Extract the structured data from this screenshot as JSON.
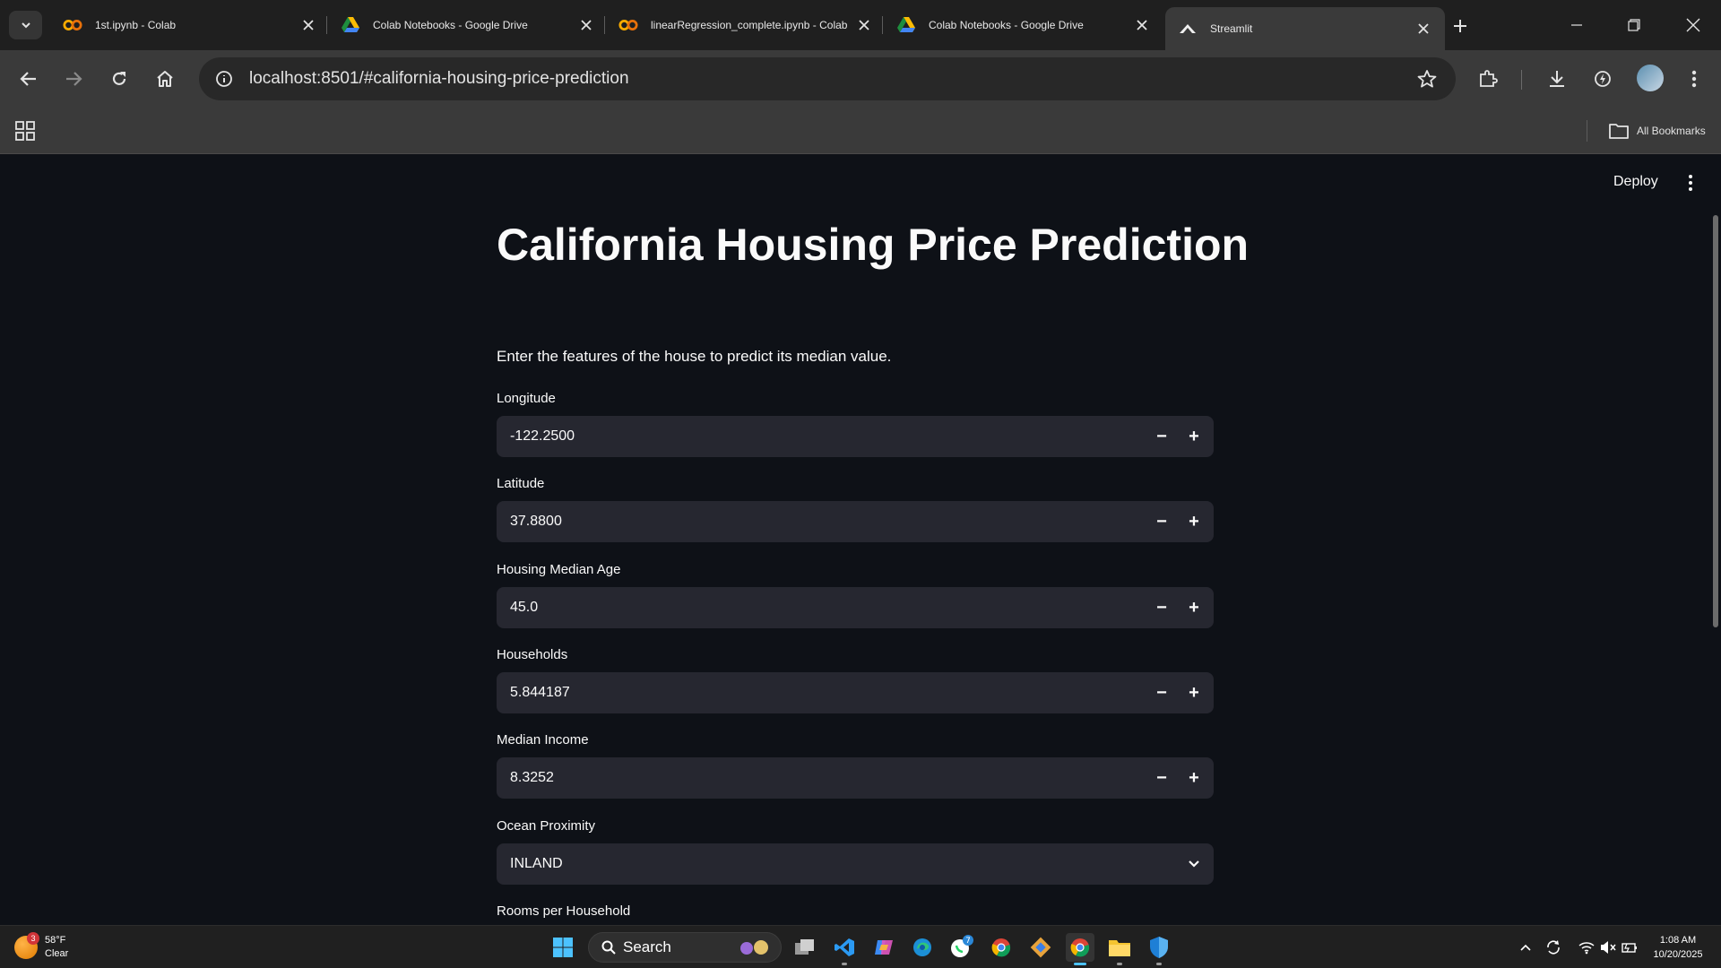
{
  "browser": {
    "tabs": [
      {
        "title": "1st.ipynb - Colab",
        "favicon": "colab-icon"
      },
      {
        "title": "Colab Notebooks - Google Drive",
        "favicon": "drive-icon"
      },
      {
        "title": "linearRegression_complete.ipynb - Colab",
        "favicon": "colab-icon"
      },
      {
        "title": "Colab Notebooks - Google Drive",
        "favicon": "drive-icon"
      },
      {
        "title": "Streamlit",
        "favicon": "streamlit-icon",
        "active": true
      }
    ],
    "url": "localhost:8501/#california-housing-price-prediction",
    "bookmarks": {
      "all_label": "All Bookmarks"
    }
  },
  "app": {
    "deploy_label": "Deploy",
    "title": "California Housing Price Prediction",
    "intro": "Enter the features of the house to predict its median value.",
    "fields": [
      {
        "label": "Longitude",
        "value": "-122.2500"
      },
      {
        "label": "Latitude",
        "value": "37.8800"
      },
      {
        "label": "Housing Median Age",
        "value": "45.0"
      },
      {
        "label": "Households",
        "value": "5.844187"
      },
      {
        "label": "Median Income",
        "value": "8.3252"
      }
    ],
    "ocean_proximity": {
      "label": "Ocean Proximity",
      "value": "INLAND"
    },
    "next_field_label": "Rooms per Household",
    "step_minus": "−",
    "step_plus": "+"
  },
  "taskbar": {
    "weather": {
      "temp": "58°F",
      "condition": "Clear",
      "badge": "3"
    },
    "search_label": "Search",
    "whatsapp_badge": "7",
    "time": "1:08 AM",
    "date": "10/20/2025"
  },
  "colors": {
    "page_bg": "#0e1117",
    "input_bg": "#262730",
    "chrome_bg": "#3a3a3a",
    "tabstrip_bg": "#1f1f1f"
  }
}
